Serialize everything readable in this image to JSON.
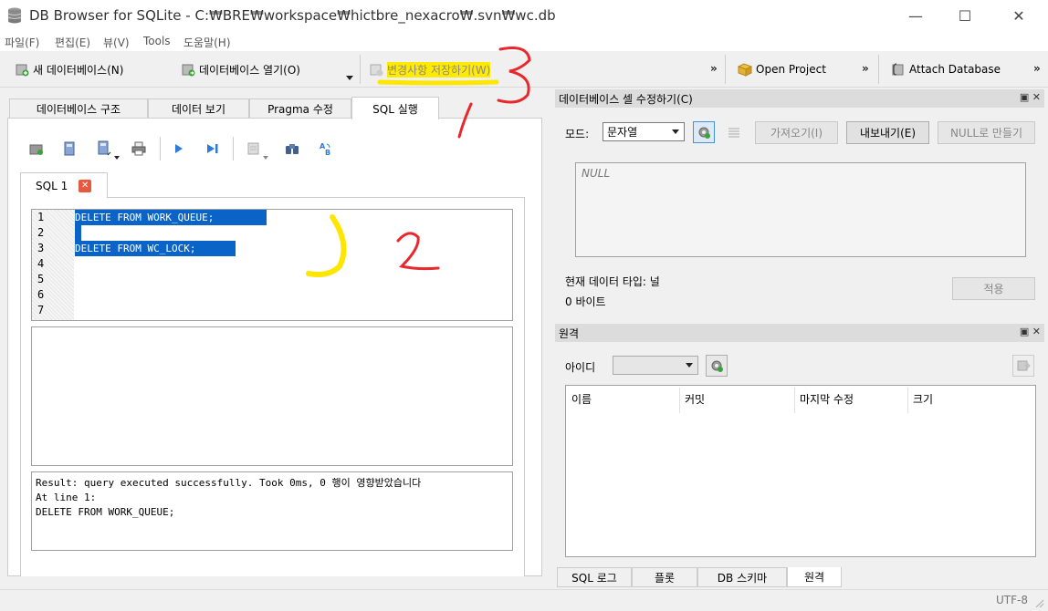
{
  "window": {
    "title": "DB Browser for SQLite - C:₩BRE₩workspace₩hictbre_nexacro₩.svn₩wc.db",
    "minimize": "—",
    "maximize": "☐",
    "close": "✕"
  },
  "menu": [
    "파일(F)",
    "편집(E)",
    "뷰(V)",
    "Tools",
    "도움말(H)"
  ],
  "toolbar": {
    "new_db": "새 데이터베이스(N)",
    "open_db": "데이터베이스 열기(O)",
    "write_changes": "변경사항 저장하기(W)",
    "open_project": "Open Project",
    "attach_db": "Attach Database",
    "more": "»"
  },
  "tabs": [
    "데이터베이스 구조",
    "데이터 보기",
    "Pragma 수정",
    "SQL 실행"
  ],
  "sql_tab": {
    "label": "SQL 1",
    "close": "✕"
  },
  "editor": {
    "line_numbers": [
      "1",
      "2",
      "3",
      "4",
      "5",
      "6",
      "7"
    ],
    "lines": [
      "DELETE FROM WORK_QUEUE;",
      "",
      "DELETE FROM WC_LOCK;",
      "",
      "",
      "",
      ""
    ]
  },
  "message": {
    "text": "Result: query executed successfully. Took 0ms, 0 행이 영향받았습니다\nAt line 1:\nDELETE FROM WORK_QUEUE;"
  },
  "cell_editor": {
    "title": "데이터베이스 셀 수정하기(C)",
    "mode_label": "모드:",
    "mode_value": "문자열",
    "import_btn": "가져오기(I)",
    "export_btn": "내보내기(E)",
    "null_btn": "NULL로 만들기",
    "content": "NULL",
    "type_label": "현재 데이터 타입: 널",
    "size_label": "0 바이트",
    "apply_btn": "적용"
  },
  "remote": {
    "title": "원격",
    "id_label": "아이디",
    "columns": [
      "이름",
      "커밋",
      "마지막 수정",
      "크기"
    ]
  },
  "bottom_tabs": [
    "SQL 로그",
    "플롯",
    "DB 스키마",
    "원격"
  ],
  "status": {
    "encoding": "UTF-8"
  },
  "annotations": {
    "n1": "1",
    "n2": "2",
    "n3": "3"
  },
  "colors": {
    "selection": "#0a64c8",
    "highlight": "#ffea00",
    "annotation_red": "#e8282d",
    "annotation_yellow": "#ffe600"
  }
}
